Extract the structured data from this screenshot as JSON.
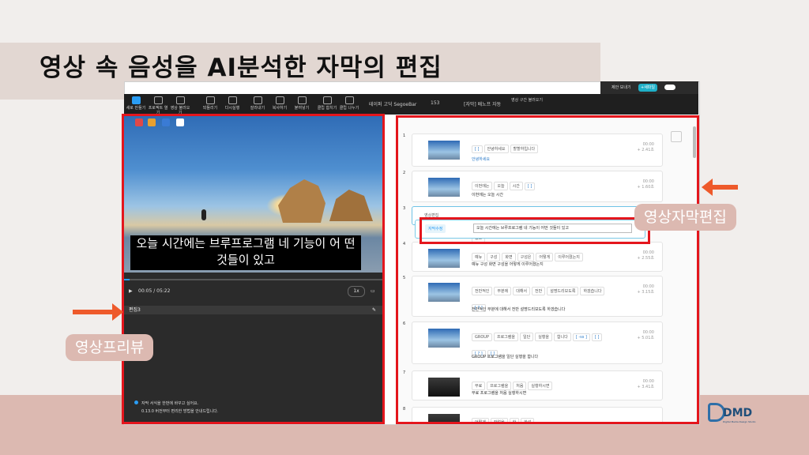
{
  "slide": {
    "title": "영상 속 음성을 AI분석한 자막의 편집",
    "callout_left": "영상프리뷰",
    "callout_right": "영상자막편집",
    "colors": {
      "highlight": "#e4161d",
      "arrow": "#ee5a2b",
      "accent": "#2a9df4",
      "band": "#dcb9b1"
    }
  },
  "topbar": {
    "share_label": "제안 보내기",
    "new_label": "+새파일"
  },
  "toolbar": {
    "tools": [
      "새로 만들기",
      "프로젝트 열기",
      "영상 불러오기",
      "되돌리기",
      "다시실행",
      "잘라내기",
      "복사하기",
      "붙여넣기",
      "클립 합치기",
      "클립 나누기"
    ],
    "font": "테이퍼 고딕 SegoeBar",
    "size": "153",
    "style_label": "[자막] 배노프 자동",
    "sync_label": "영상 구간 불러오기"
  },
  "preview": {
    "subtitle": "오늘 시간에는 브루프로그램 네 기능이 어 떤 것들이 있고",
    "time": "00:05 / 05:22",
    "speed": "1x",
    "progress": 0.02,
    "track_label": "편집3",
    "notice_line1": "자막 서식을 한번에 바꾸고 싶어요.",
    "notice_line2": "0.13.0 버전부터 편리한 방법을 안내드립니다."
  },
  "subtitles": [
    {
      "num": "1",
      "words": [
        "[ ]",
        "안녕하세요",
        "할할하입니다"
      ],
      "sentence": "안녕하세요",
      "t1": "00:00",
      "t2": "+ 2.41초",
      "dark": false
    },
    {
      "num": "2",
      "words": [
        "이번에는",
        "오늘",
        "시간",
        "[ ]"
      ],
      "sentence": "이번에는 오늘 시간",
      "t1": "00:00",
      "t2": "+ 1.60초",
      "dark": false
    },
    {
      "num": "3",
      "label": "영상편집",
      "words": [
        "오늘",
        "시간에는",
        "브루프로그램",
        "네",
        "기능이",
        "어떤",
        "것들이",
        "있고"
      ],
      "sentence": "",
      "t1": "",
      "t2": "",
      "dark": false
    },
    {
      "num": "4",
      "words": [
        "예뉴",
        "구성",
        "화면",
        "구성은",
        "어떻게",
        "이루어졌는지"
      ],
      "sentence": "예뉴 구성 화면 구성을 어떻게 이루어졌는지",
      "t1": "00:00",
      "t2": "+ 2.55초",
      "dark": false
    },
    {
      "num": "5",
      "words": [
        "전반적인",
        "부분에",
        "대해서",
        "전반",
        "설명드리보도록",
        "하겠습니다",
        "[ ? ]"
      ],
      "sentence": "전반적인 부분에 대해서 전반 설명드리보도록 하겠습니다",
      "t1": "00:00",
      "t2": "+ 3.15초",
      "dark": false
    },
    {
      "num": "6",
      "words": [
        "GROUP",
        "프로그램을",
        "일단",
        "실행을",
        "합니다",
        "[ -ss ]",
        "[ ]",
        "[ ? ]",
        "[ ]"
      ],
      "sentence": "GROUP 프로그램을 일단 실행을 합니다",
      "t1": "00:00",
      "t2": "+ 5.01초",
      "dark": false
    },
    {
      "num": "7",
      "words": [
        "무료",
        "프로그램을",
        "처음",
        "실행하시면"
      ],
      "sentence": "무료 프로그램을 처음 실행하시면",
      "t1": "00:00",
      "t2": "+ 3.41초",
      "dark": true
    },
    {
      "num": "8",
      "words": [
        "어떻게",
        "작업을",
        "한",
        "화성"
      ],
      "sentence": "",
      "t1": "",
      "t2": "",
      "dark": true
    }
  ],
  "edit": {
    "tag": "자막수정",
    "value": "오늘 시간에는 브루프로그램 네 기능이 어떤 것들이 있고"
  },
  "logo": {
    "text": "DMD",
    "sub": "Digital Media Design Studio"
  }
}
